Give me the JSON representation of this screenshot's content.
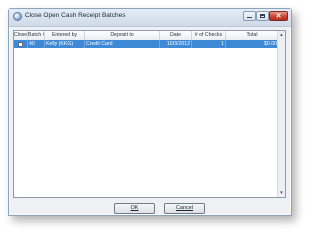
{
  "window": {
    "title": "Close Open Cash Receipt Batches",
    "controls": {
      "minimize": "minimize",
      "maximize": "maximize",
      "close": "✕"
    }
  },
  "table": {
    "columns": [
      "Close",
      "Batch #",
      "Entered by",
      "Deposit to",
      "Date",
      "# of Checks",
      "Total"
    ],
    "rows": [
      {
        "close_checked": false,
        "batch": "40",
        "entered_by": "Kelly (KKG)",
        "deposit_to": "Credit Card",
        "date": "10/3/2012",
        "checks": "1",
        "total": "$0.00"
      }
    ],
    "selected_row_color": "#3d89d6"
  },
  "buttons": {
    "ok_label": "OK",
    "cancel_label": "Cancel"
  }
}
